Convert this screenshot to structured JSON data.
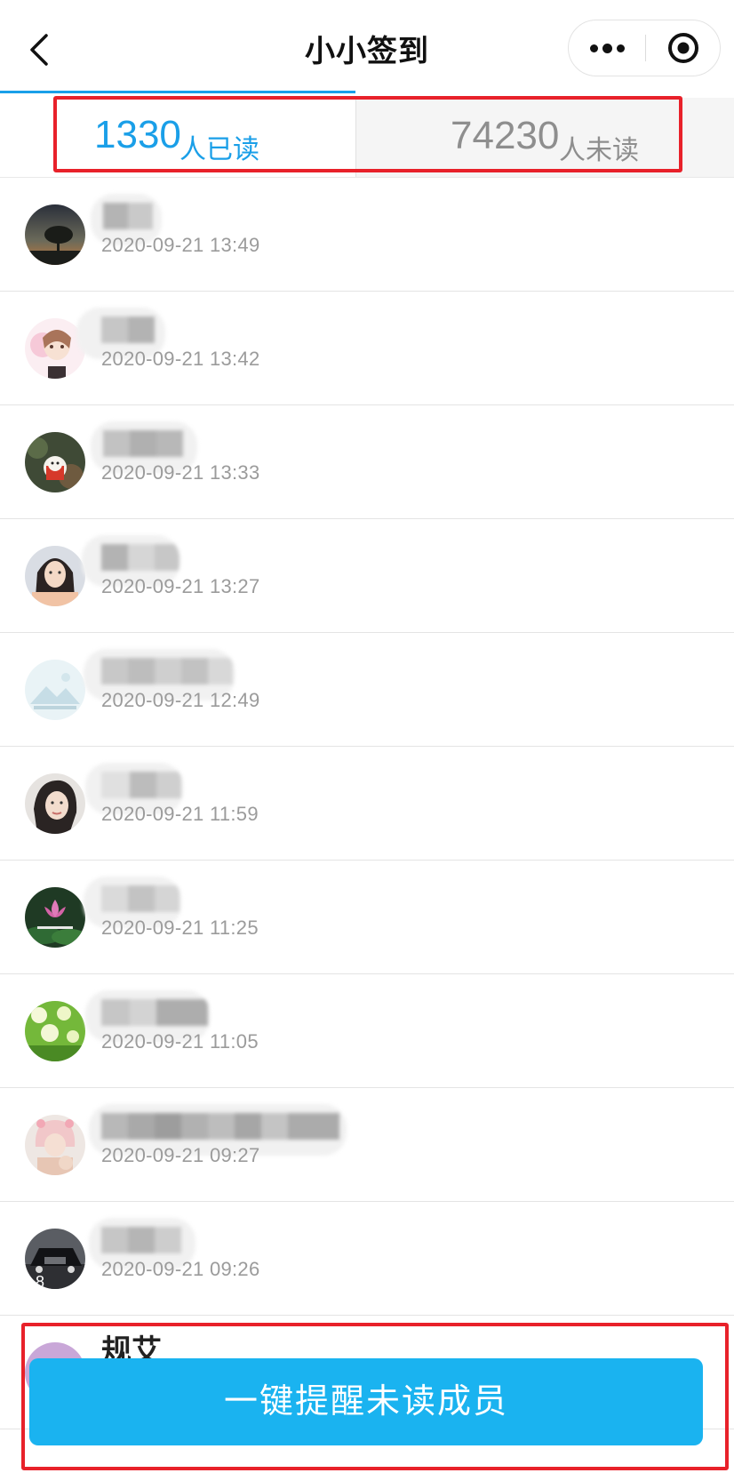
{
  "header": {
    "title": "小小签到"
  },
  "tabs": {
    "read": {
      "count": "1330",
      "label": "人已读"
    },
    "unread": {
      "count": "74230",
      "label": "人未读"
    }
  },
  "members": [
    {
      "time": "2020-09-21 13:49",
      "avatar": "sunset-tree"
    },
    {
      "time": "2020-09-21 13:42",
      "avatar": "anime-girl"
    },
    {
      "time": "2020-09-21 13:33",
      "avatar": "lucky-cat"
    },
    {
      "time": "2020-09-21 13:27",
      "avatar": "woman-portrait"
    },
    {
      "time": "2020-09-21 12:49",
      "avatar": "placeholder-landscape"
    },
    {
      "time": "2020-09-21 11:59",
      "avatar": "woman-portrait"
    },
    {
      "time": "2020-09-21 11:25",
      "avatar": "lotus-flower"
    },
    {
      "time": "2020-09-21 11:05",
      "avatar": "dandelion-field"
    },
    {
      "time": "2020-09-21 09:27",
      "avatar": "girl-with-hat"
    },
    {
      "time": "2020-09-21 09:26",
      "avatar": "black-car"
    }
  ],
  "partial_member": {
    "name": "规艾"
  },
  "remind_button": {
    "label": "一键提醒未读成员"
  }
}
